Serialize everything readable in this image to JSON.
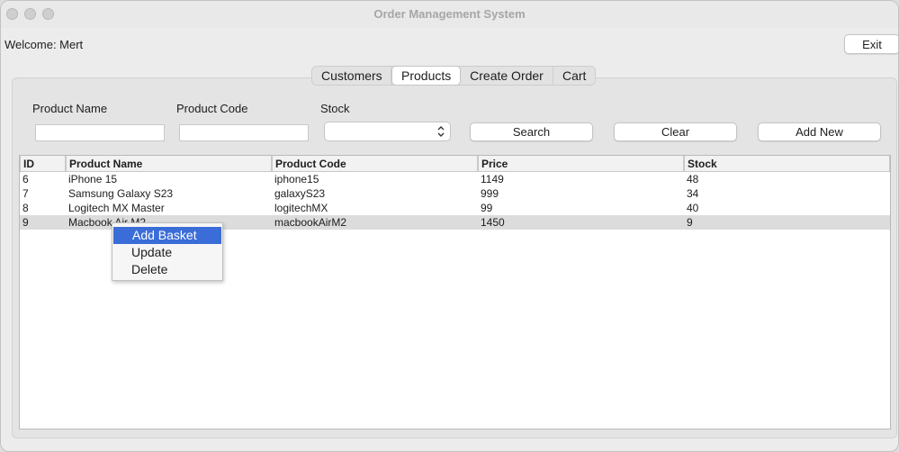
{
  "window": {
    "title": "Order Management System"
  },
  "header": {
    "welcome": "Welcome: Mert",
    "exit_label": "Exit"
  },
  "tabs": [
    {
      "label": "Customers",
      "active": false
    },
    {
      "label": "Products",
      "active": true
    },
    {
      "label": "Create Order",
      "active": false
    },
    {
      "label": "Cart",
      "active": false
    }
  ],
  "filters": {
    "product_name_label": "Product Name",
    "product_code_label": "Product Code",
    "stock_label": "Stock",
    "product_name_value": "",
    "product_code_value": "",
    "stock_value": ""
  },
  "buttons": {
    "search": "Search",
    "clear": "Clear",
    "add_new": "Add New"
  },
  "table": {
    "columns": [
      "ID",
      "Product Name",
      "Product Code",
      "Price",
      "Stock"
    ],
    "rows": [
      [
        "6",
        "iPhone 15",
        "iphone15",
        "1149",
        "48"
      ],
      [
        "7",
        "Samsung Galaxy S23",
        "galaxyS23",
        "999",
        "34"
      ],
      [
        "8",
        "Logitech MX Master",
        "logitechMX",
        "99",
        "40"
      ],
      [
        "9",
        "Macbook Air M2",
        "macbookAirM2",
        "1450",
        "9"
      ]
    ],
    "selected_row": 3
  },
  "context_menu": {
    "items": [
      "Add Basket",
      "Update",
      "Delete"
    ],
    "highlighted": 0
  },
  "colors": {
    "highlight": "#3b6dd8",
    "selected_row": "#dcdcdc"
  },
  "icons": {
    "stock_select": "chevron-up-down-icon"
  }
}
